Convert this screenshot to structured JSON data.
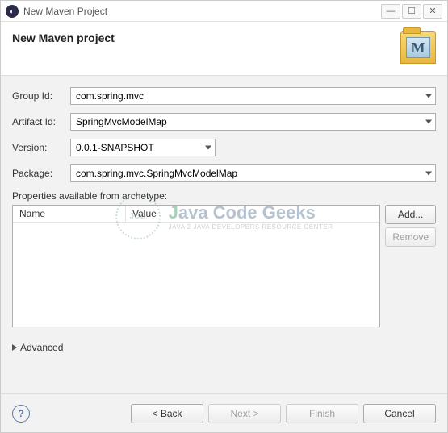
{
  "titlebar": {
    "title": "New Maven Project"
  },
  "header": {
    "heading": "New Maven project",
    "icon_letter": "M"
  },
  "form": {
    "group_id_label": "Group Id:",
    "group_id_value": "com.spring.mvc",
    "artifact_id_label": "Artifact Id:",
    "artifact_id_value": "SpringMvcModelMap",
    "version_label": "Version:",
    "version_value": "0.0.1-SNAPSHOT",
    "package_label": "Package:",
    "package_value": "com.spring.mvc.SpringMvcModelMap"
  },
  "properties": {
    "section_label": "Properties available from archetype:",
    "col_name": "Name",
    "col_value": "Value",
    "add_button": "Add...",
    "remove_button": "Remove"
  },
  "advanced": {
    "label": "Advanced"
  },
  "footer": {
    "help": "?",
    "back": "< Back",
    "next": "Next >",
    "finish": "Finish",
    "cancel": "Cancel"
  },
  "watermark": {
    "badge": "JCG",
    "main_j": "J",
    "main_rest": "ava Code Geeks",
    "sub": "JAVA 2 JAVA DEVELOPERS RESOURCE CENTER"
  }
}
